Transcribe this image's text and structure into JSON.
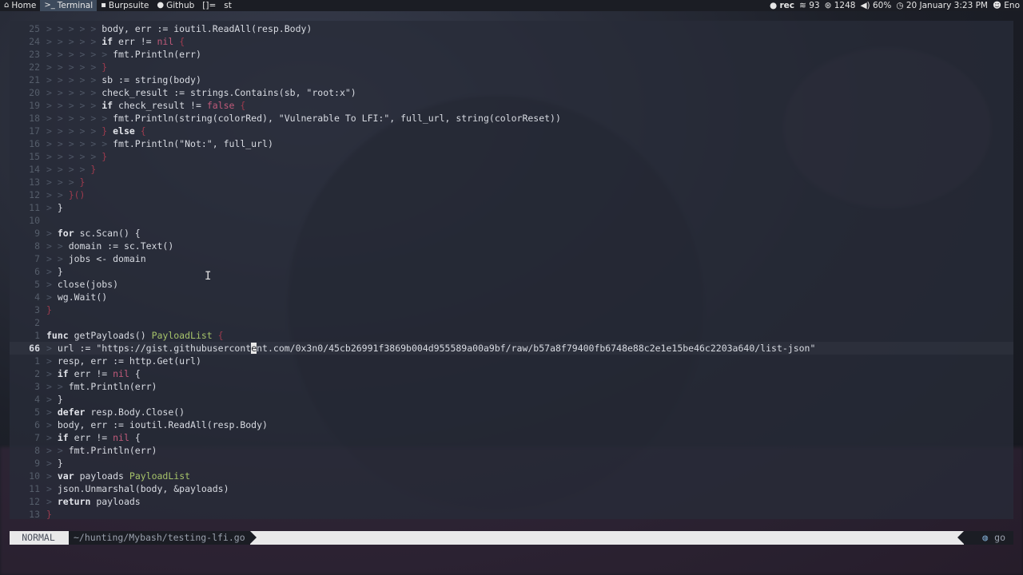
{
  "topbar": {
    "workspaces": [
      {
        "icon": "home-icon",
        "glyph": "⌂",
        "label": "Home",
        "active": false
      },
      {
        "icon": "terminal-icon",
        "glyph": ">_",
        "label": "Terminal",
        "active": true
      },
      {
        "icon": "burpsuite-icon",
        "glyph": "▪",
        "label": "Burpsuite",
        "active": false
      },
      {
        "icon": "github-icon",
        "glyph": "●",
        "label": "Github",
        "active": false
      }
    ],
    "layout": "[]=",
    "window_title": "st",
    "status": {
      "rec": "rec",
      "wifi": "93",
      "memory": "1248",
      "volume": "60%",
      "datetime": "20 January 3:23 PM",
      "user": "Eno"
    }
  },
  "editor": {
    "current_line_label": "66",
    "lines": [
      {
        "n": "25",
        "code": [
          [
            "ind",
            "> > > > > "
          ],
          [
            "",
            "body, err := ioutil.ReadAll(resp.Body)"
          ]
        ]
      },
      {
        "n": "24",
        "code": [
          [
            "ind",
            "> > > > > "
          ],
          [
            "kw",
            "if"
          ],
          [
            "",
            " err != "
          ],
          [
            "nil",
            "nil"
          ],
          [
            "br",
            " {"
          ]
        ]
      },
      {
        "n": "23",
        "code": [
          [
            "ind",
            "> > > > > > "
          ],
          [
            "",
            "fmt.Println(err)"
          ]
        ]
      },
      {
        "n": "22",
        "code": [
          [
            "ind",
            "> > > > > "
          ],
          [
            "br",
            "}"
          ]
        ]
      },
      {
        "n": "21",
        "code": [
          [
            "ind",
            "> > > > > "
          ],
          [
            "",
            "sb := string(body)"
          ]
        ]
      },
      {
        "n": "20",
        "code": [
          [
            "ind",
            "> > > > > "
          ],
          [
            "",
            "check_result := strings.Contains(sb, \"root:x\")"
          ]
        ]
      },
      {
        "n": "19",
        "code": [
          [
            "ind",
            "> > > > > "
          ],
          [
            "kw",
            "if"
          ],
          [
            "",
            " check_result != "
          ],
          [
            "nil",
            "false"
          ],
          [
            "br",
            " {"
          ]
        ]
      },
      {
        "n": "18",
        "code": [
          [
            "ind",
            "> > > > > > "
          ],
          [
            "",
            "fmt.Println(string(colorRed), \"Vulnerable To LFI:\", full_url, string(colorReset))"
          ]
        ]
      },
      {
        "n": "17",
        "code": [
          [
            "ind",
            "> > > > > "
          ],
          [
            "br",
            "} "
          ],
          [
            "kw",
            "else"
          ],
          [
            "br",
            " {"
          ]
        ]
      },
      {
        "n": "16",
        "code": [
          [
            "ind",
            "> > > > > > "
          ],
          [
            "",
            "fmt.Println(\"Not:\", full_url)"
          ]
        ]
      },
      {
        "n": "15",
        "code": [
          [
            "ind",
            "> > > > > "
          ],
          [
            "br",
            "}"
          ]
        ]
      },
      {
        "n": "14",
        "code": [
          [
            "ind",
            "> > > > "
          ],
          [
            "br",
            "}"
          ]
        ]
      },
      {
        "n": "13",
        "code": [
          [
            "ind",
            "> > > "
          ],
          [
            "br",
            "}"
          ]
        ]
      },
      {
        "n": "12",
        "code": [
          [
            "ind",
            "> > "
          ],
          [
            "br",
            "}()"
          ]
        ]
      },
      {
        "n": "11",
        "code": [
          [
            "ind",
            "> "
          ],
          [
            "",
            "}"
          ]
        ]
      },
      {
        "n": "10",
        "code": [
          [
            "",
            ""
          ]
        ]
      },
      {
        "n": "9",
        "code": [
          [
            "ind",
            "> "
          ],
          [
            "kw",
            "for"
          ],
          [
            "",
            " sc.Scan() {"
          ]
        ]
      },
      {
        "n": "8",
        "code": [
          [
            "ind",
            "> > "
          ],
          [
            "",
            "domain := sc.Text()"
          ]
        ]
      },
      {
        "n": "7",
        "code": [
          [
            "ind",
            "> > "
          ],
          [
            "",
            "jobs <- domain"
          ]
        ]
      },
      {
        "n": "6",
        "code": [
          [
            "ind",
            "> "
          ],
          [
            "",
            "}"
          ]
        ]
      },
      {
        "n": "5",
        "code": [
          [
            "ind",
            "> "
          ],
          [
            "",
            "close(jobs)"
          ]
        ]
      },
      {
        "n": "4",
        "code": [
          [
            "ind",
            "> "
          ],
          [
            "",
            "wg.Wait()"
          ]
        ]
      },
      {
        "n": "3",
        "code": [
          [
            "br",
            "}"
          ]
        ]
      },
      {
        "n": "2",
        "code": [
          [
            "",
            ""
          ]
        ]
      },
      {
        "n": "1",
        "code": [
          [
            "kw",
            "func"
          ],
          [
            "",
            " getPayloads() "
          ],
          [
            "typ",
            "PayloadList"
          ],
          [
            "br",
            " {"
          ]
        ]
      },
      {
        "n": "66",
        "cur": true,
        "code": [
          [
            "ind",
            "> "
          ],
          [
            "",
            "url := \"https://gist.githubusercont"
          ],
          [
            "cursor",
            "e"
          ],
          [
            "",
            "nt.com/0x3n0/45cb26991f3869b004d955589a00a9bf/raw/b57a8f79400fb6748e88c2e1e15be46c2203a640/list-json\""
          ]
        ]
      },
      {
        "n": "1",
        "code": [
          [
            "ind",
            "> "
          ],
          [
            "",
            "resp, err := http.Get(url)"
          ]
        ]
      },
      {
        "n": "2",
        "code": [
          [
            "ind",
            "> "
          ],
          [
            "kw",
            "if"
          ],
          [
            "",
            " err != "
          ],
          [
            "nil",
            "nil"
          ],
          [
            "",
            " {"
          ]
        ]
      },
      {
        "n": "3",
        "code": [
          [
            "ind",
            "> > "
          ],
          [
            "",
            "fmt.Println(err)"
          ]
        ]
      },
      {
        "n": "4",
        "code": [
          [
            "ind",
            "> "
          ],
          [
            "",
            "}"
          ]
        ]
      },
      {
        "n": "5",
        "code": [
          [
            "ind",
            "> "
          ],
          [
            "kw",
            "defer"
          ],
          [
            "",
            " resp.Body.Close()"
          ]
        ]
      },
      {
        "n": "6",
        "code": [
          [
            "ind",
            "> "
          ],
          [
            "",
            "body, err := ioutil.ReadAll(resp.Body)"
          ]
        ]
      },
      {
        "n": "7",
        "code": [
          [
            "ind",
            "> "
          ],
          [
            "kw",
            "if"
          ],
          [
            "",
            " err != "
          ],
          [
            "nil",
            "nil"
          ],
          [
            "",
            " {"
          ]
        ]
      },
      {
        "n": "8",
        "code": [
          [
            "ind",
            "> > "
          ],
          [
            "",
            "fmt.Println(err)"
          ]
        ]
      },
      {
        "n": "9",
        "code": [
          [
            "ind",
            "> "
          ],
          [
            "",
            "}"
          ]
        ]
      },
      {
        "n": "10",
        "code": [
          [
            "ind",
            "> "
          ],
          [
            "kw",
            "var"
          ],
          [
            "",
            " payloads "
          ],
          [
            "typ",
            "PayloadList"
          ]
        ]
      },
      {
        "n": "11",
        "code": [
          [
            "ind",
            "> "
          ],
          [
            "",
            "json.Unmarshal(body, &payloads)"
          ]
        ]
      },
      {
        "n": "12",
        "code": [
          [
            "ind",
            "> "
          ],
          [
            "kw",
            "return"
          ],
          [
            "",
            " payloads"
          ]
        ]
      },
      {
        "n": "13",
        "code": [
          [
            "br",
            "}"
          ]
        ]
      }
    ]
  },
  "statusline": {
    "mode": "NORMAL",
    "path": "~/hunting/Mybash/testing-lfi.go",
    "filetype_icon": "go-gopher-icon",
    "filetype": "go"
  }
}
